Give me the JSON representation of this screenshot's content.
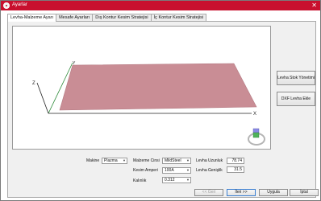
{
  "window": {
    "title": "Ayarlar",
    "close_glyph": "✕"
  },
  "tabs": [
    {
      "label": "Levha-Malzeme Ayarı"
    },
    {
      "label": "Mesafe Ayarları"
    },
    {
      "label": "Dış Kontur Kesim Stratejisi"
    },
    {
      "label": "İç Kontur Kesim Stratejisi"
    }
  ],
  "viewport": {
    "axes": {
      "x": "X",
      "y": "Y",
      "z": "Z"
    },
    "plate_color": "#c98d95",
    "axis_color_y": "#2e8b3a"
  },
  "side_buttons": {
    "sheet_manage": "Levha Stok Yönetimi",
    "dxf_add": "DXF Levha Ekle"
  },
  "form": {
    "machine": {
      "label": "Makine",
      "value": "Plazma"
    },
    "material": {
      "label": "Malzeme Cinsi",
      "value": "MildSteel"
    },
    "current": {
      "label": "Kesim Amperi",
      "value": "100A"
    },
    "thickness": {
      "label": "Kalınlık",
      "value": "0.312"
    },
    "sheet_length": {
      "label": "Levha Uzunluk",
      "value": "78.74"
    },
    "sheet_width": {
      "label": "Levha Genişlik",
      "value": "31.5"
    }
  },
  "buttons": {
    "back": "<< Geri",
    "next": "İleri >>",
    "apply": "Uygula",
    "cancel": "İptal"
  }
}
